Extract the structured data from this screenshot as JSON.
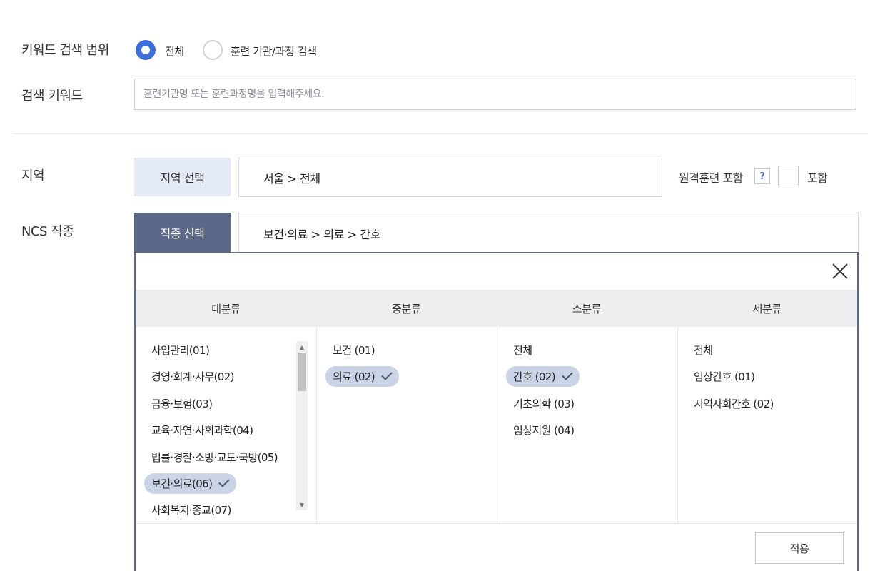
{
  "keyword_scope": {
    "label": "키워드 검색 범위",
    "options": [
      {
        "label": "전체",
        "selected": true
      },
      {
        "label": "훈련 기관/과정 검색",
        "selected": false
      }
    ]
  },
  "keyword": {
    "label": "검색 키워드",
    "placeholder": "훈련기관명 또는 훈련과정명을 입력해주세요.",
    "value": ""
  },
  "region": {
    "label": "지역",
    "button_label": "지역 선택",
    "value": "서울 > 전체",
    "remote_label": "원격훈련 포함",
    "help_label": "?",
    "include_label": "포함",
    "include_checked": false
  },
  "ncs": {
    "label": "NCS 직종",
    "button_label": "직종 선택",
    "value": "보건·의료 > 의료 > 간호",
    "columns": {
      "major": {
        "header": "대분류",
        "items": [
          "사업관리(01)",
          "경영·회계·사무(02)",
          "금융·보험(03)",
          "교육·자연·사회과학(04)",
          "법률·경찰·소방·교도·국방(05)",
          "보건·의료(06)",
          "사회복지·종교(07)"
        ],
        "selected_index": 5
      },
      "middle": {
        "header": "중분류",
        "items": [
          "보건 (01)",
          "의료 (02)"
        ],
        "selected_index": 1
      },
      "minor": {
        "header": "소분류",
        "items": [
          "전체",
          "간호 (02)",
          "기초의학 (03)",
          "임상지원 (04)"
        ],
        "selected_index": 1
      },
      "detail": {
        "header": "세분류",
        "items": [
          "전체",
          "임상간호 (01)",
          "지역사회간호 (02)"
        ],
        "selected_index": -1
      }
    },
    "apply_label": "적용"
  },
  "colors": {
    "accent": "#3d6fd8",
    "job_button": "#5c6887",
    "region_button": "#e4ebf7",
    "selected_chip": "#cbd4e6"
  }
}
